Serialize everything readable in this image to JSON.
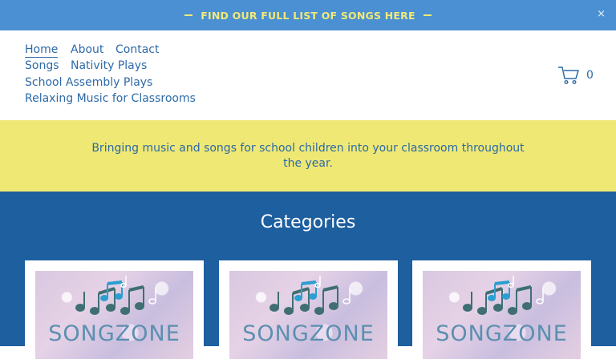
{
  "announcement": {
    "text": "FIND OUR FULL LIST OF SONGS HERE",
    "close_symbol": "×"
  },
  "nav": {
    "home": "Home",
    "about": "About",
    "contact": "Contact",
    "songs": "Songs",
    "nativity_plays": "Nativity Plays",
    "school_assembly_plays": "School Assembly Plays",
    "relaxing_music": "Relaxing Music for Classrooms"
  },
  "cart": {
    "count": "0",
    "icon": "cart-icon"
  },
  "tagline": "Bringing music and songs for school children into your classroom throughout the year.",
  "categories": {
    "title": "Categories",
    "cards": [
      {
        "logo_text": "SONGZONE",
        "icon": "music-notes-icon"
      },
      {
        "logo_text": "SONGZONE",
        "icon": "music-notes-icon"
      },
      {
        "logo_text": "SONGZONE",
        "icon": "music-notes-icon"
      }
    ]
  },
  "colors": {
    "announcement_bg": "#4a90d2",
    "announcement_text": "#f1e978",
    "nav_text": "#2d6aa8",
    "tagline_bg": "#f0e874",
    "categories_bg": "#1e5f9f"
  }
}
